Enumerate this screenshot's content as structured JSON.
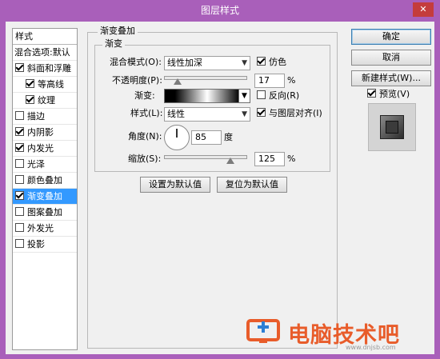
{
  "window": {
    "title": "图层样式",
    "close": "✕"
  },
  "styles_list": {
    "header": "样式",
    "blend_options": "混合选项:默认",
    "items": [
      {
        "label": "斜面和浮雕",
        "checked": true,
        "indent": false,
        "selected": false
      },
      {
        "label": "等高线",
        "checked": true,
        "indent": true,
        "selected": false
      },
      {
        "label": "纹理",
        "checked": true,
        "indent": true,
        "selected": false
      },
      {
        "label": "描边",
        "checked": false,
        "indent": false,
        "selected": false
      },
      {
        "label": "内阴影",
        "checked": true,
        "indent": false,
        "selected": false
      },
      {
        "label": "内发光",
        "checked": true,
        "indent": false,
        "selected": false
      },
      {
        "label": "光泽",
        "checked": false,
        "indent": false,
        "selected": false
      },
      {
        "label": "颜色叠加",
        "checked": false,
        "indent": false,
        "selected": false
      },
      {
        "label": "渐变叠加",
        "checked": true,
        "indent": false,
        "selected": true
      },
      {
        "label": "图案叠加",
        "checked": false,
        "indent": false,
        "selected": false
      },
      {
        "label": "外发光",
        "checked": false,
        "indent": false,
        "selected": false
      },
      {
        "label": "投影",
        "checked": false,
        "indent": false,
        "selected": false
      }
    ]
  },
  "panel": {
    "group_title": "渐变叠加",
    "subgroup_title": "渐变",
    "blend_mode_label": "混合模式(O):",
    "blend_mode_value": "线性加深",
    "dither_label": "仿色",
    "dither_checked": true,
    "opacity_label": "不透明度(P):",
    "opacity_value": "17",
    "opacity_percent": 17,
    "opacity_unit": "%",
    "gradient_label": "渐变:",
    "reverse_label": "反向(R)",
    "reverse_checked": false,
    "style_label": "样式(L):",
    "style_value": "线性",
    "align_label": "与图层对齐(I)",
    "align_checked": true,
    "angle_label": "角度(N):",
    "angle_value": "85",
    "angle_unit": "度",
    "scale_label": "缩放(S):",
    "scale_value": "125",
    "scale_unit": "%",
    "set_default_button": "设置为默认值",
    "reset_default_button": "复位为默认值"
  },
  "actions": {
    "ok": "确定",
    "cancel": "取消",
    "new_style": "新建样式(W)...",
    "preview_label": "预览(V)",
    "preview_checked": true
  },
  "watermark": {
    "text": "电脑技术吧",
    "url": "www.dnjsb.com",
    "colors": {
      "orange": "#e85c2a",
      "blue": "#2d7fd3"
    }
  }
}
